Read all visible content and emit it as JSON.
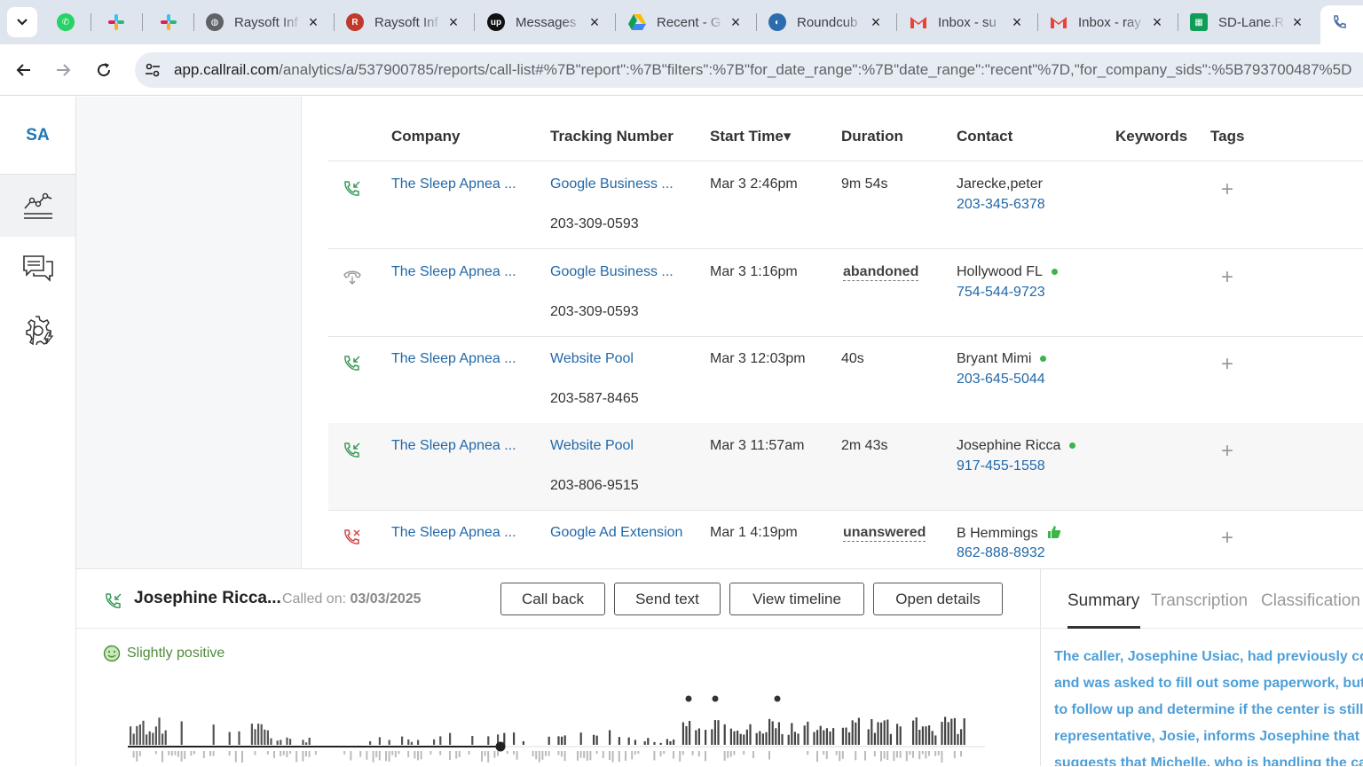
{
  "browser": {
    "tabs": [
      {
        "label": "",
        "icon": "whatsapp-icon",
        "color": "#25d366"
      },
      {
        "label": "",
        "icon": "slack-icon",
        "color": "#e01e5a"
      },
      {
        "label": "",
        "icon": "slack-icon",
        "color": "#e01e5a"
      },
      {
        "label": "Raysoft Inf",
        "icon": "globe-icon",
        "color": "#5f6368"
      },
      {
        "label": "Raysoft Inf",
        "icon": "raysoft-icon",
        "color": "#c0392b"
      },
      {
        "label": "Messages",
        "icon": "upwork-icon",
        "color": "#111111"
      },
      {
        "label": "Recent - G",
        "icon": "google-drive-icon",
        "color": "#1a73e8"
      },
      {
        "label": "Roundcub",
        "icon": "roundcube-icon",
        "color": "#2b6cb0"
      },
      {
        "label": "Inbox - su",
        "icon": "gmail-icon",
        "color": "#ea4335"
      },
      {
        "label": "Inbox - ray",
        "icon": "gmail-icon",
        "color": "#ea4335"
      },
      {
        "label": "SD-Lane.R",
        "icon": "sheets-icon",
        "color": "#0f9d58"
      }
    ],
    "url_host": "app.callrail.com",
    "url_path": "/analytics/a/537900785/reports/call-list#%7B\"report\":%7B\"filters\":%7B\"for_date_range\":%7B\"date_range\":\"recent\"%7D,\"for_company_sids\":%5B793700487%5D"
  },
  "sidebar": {
    "brand": "SA",
    "items": [
      {
        "name": "analytics-nav",
        "icon": "chart-line-icon"
      },
      {
        "name": "conversations-nav",
        "icon": "chat-icon"
      },
      {
        "name": "settings-nav",
        "icon": "gear-bolt-icon"
      }
    ]
  },
  "table": {
    "headers": [
      "Company",
      "Tracking Number",
      "Start Time▾",
      "Duration",
      "Contact",
      "Keywords",
      "Tags"
    ],
    "rows": [
      {
        "status": "answered",
        "company": "The Sleep Apnea ...",
        "source": "Google Business ...",
        "tracking": "203-309-0593",
        "start": "Mar 3 2:46pm",
        "duration": "9m 54s",
        "contact": "Jarecke,peter",
        "phone": "203-345-6378",
        "dot": false
      },
      {
        "status": "abandoned",
        "company": "The Sleep Apnea ...",
        "source": "Google Business ...",
        "tracking": "203-309-0593",
        "start": "Mar 3 1:16pm",
        "duration": "abandoned",
        "contact": "Hollywood FL",
        "phone": "754-544-9723",
        "dot": true
      },
      {
        "status": "answered",
        "company": "The Sleep Apnea ...",
        "source": "Website Pool",
        "tracking": "203-587-8465",
        "start": "Mar 3 12:03pm",
        "duration": "40s",
        "contact": "Bryant Mimi",
        "phone": "203-645-5044",
        "dot": true
      },
      {
        "status": "answered",
        "company": "The Sleep Apnea ...",
        "source": "Website Pool",
        "tracking": "203-806-9515",
        "start": "Mar 3 11:57am",
        "duration": "2m 43s",
        "contact": "Josephine Ricca",
        "phone": "917-455-1558",
        "dot": true
      },
      {
        "status": "missed",
        "company": "The Sleep Apnea ...",
        "source": "Google Ad Extension",
        "tracking": "",
        "start": "Mar 1 4:19pm",
        "duration": "unanswered",
        "contact": "B Hemmings",
        "phone": "862-888-8932",
        "dot": false,
        "thumb": true
      }
    ]
  },
  "detail": {
    "caller": "Josephine Ricca...",
    "called_on_label": "Called on:",
    "called_on_date": "03/03/2025",
    "buttons": [
      "Call back",
      "Send text",
      "View timeline",
      "Open details"
    ],
    "sentiment": "Slightly positive"
  },
  "summary": {
    "tabs": [
      "Summary",
      "Transcription",
      "Classification"
    ],
    "lines": [
      "The caller, Josephine Usiac, had previously cor",
      "and was asked to fill out some paperwork, but",
      "to follow up and determine if the center is still",
      "representative, Josie, informs Josephine that t",
      "suggests that Michelle, who is handling the ca"
    ]
  },
  "colors": {
    "link": "#2268a8",
    "positive": "#3cb44b",
    "summary_text": "#4d9fd8",
    "missed": "#d64545"
  }
}
